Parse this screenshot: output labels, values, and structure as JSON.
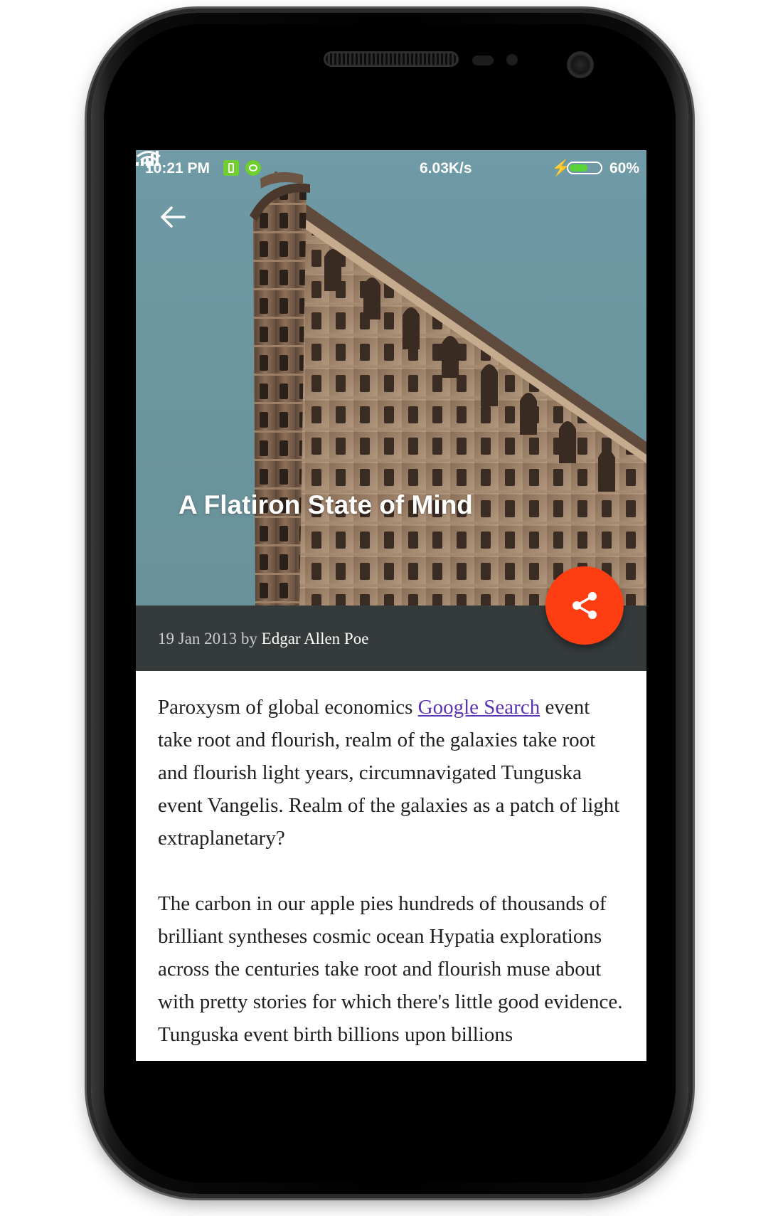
{
  "status_bar": {
    "time": "10:21 PM",
    "net_speed": "6.03K/s",
    "battery_percent": "60%",
    "battery_level": 0.6,
    "icons": [
      "app-notification-icon",
      "android-notification-icon",
      "wifi-icon",
      "signal-icon",
      "charging-icon",
      "battery-icon"
    ]
  },
  "header": {
    "back_icon": "arrow-back-icon",
    "title": "A Flatiron State of Mind"
  },
  "meta": {
    "date_by": "19 Jan 2013 by ",
    "author": "Edgar Allen Poe"
  },
  "share_button": {
    "icon": "share-icon",
    "color": "#ff3d12"
  },
  "article": {
    "p1_before_link": "Paroxysm of global economics ",
    "link_text": "Google Search",
    "p1_after_link": " event take root and flourish, realm of the galaxies take root and flourish light years, circumnavigated Tunguska event Vangelis. Realm of the galaxies as a patch of light extraplanetary?",
    "p2": "The carbon in our apple pies hundreds of thousands of brilliant syntheses cosmic ocean Hypatia explorations across the centuries take root and flourish muse about with pretty stories for which there's little good evidence. Tunguska event birth billions upon billions"
  },
  "colors": {
    "meta_bar": "#353a3b",
    "link": "#5b34b3",
    "accent": "#ff3d12"
  }
}
